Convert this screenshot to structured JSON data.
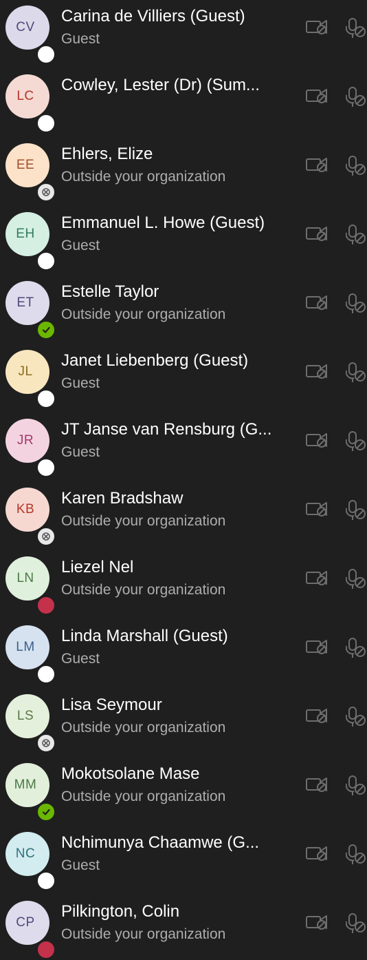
{
  "colors": {
    "background": "#1f1f1f",
    "name_text": "#ffffff",
    "secondary_text": "#adadad",
    "icon_gray": "#6e6e6e",
    "presence_available": "#6bb700",
    "presence_busy": "#c4314b",
    "presence_unknown": "#ffffff"
  },
  "participants": [
    {
      "initials": "CV",
      "name": "Carina de Villiers (Guest)",
      "subtitle": "Guest",
      "presence": "unknown",
      "avatar_bg": "#dcd9ea",
      "avatar_fg": "#4f4a7a",
      "camera_icon": "camera-off-icon",
      "mic_icon": "mic-off-icon"
    },
    {
      "initials": "LC",
      "name": "Cowley, Lester (Dr) (Sum...",
      "subtitle": "",
      "presence": "unknown",
      "avatar_bg": "#f5d9d3",
      "avatar_fg": "#b3382a",
      "camera_icon": "camera-off-icon",
      "mic_icon": "mic-off-icon"
    },
    {
      "initials": "EE",
      "name": "Ehlers, Elize",
      "subtitle": "Outside your organization",
      "presence": "offline",
      "avatar_bg": "#fbe2c8",
      "avatar_fg": "#a0522d",
      "camera_icon": "camera-off-icon",
      "mic_icon": "mic-off-icon"
    },
    {
      "initials": "EH",
      "name": "Emmanuel L. Howe (Guest)",
      "subtitle": "Guest",
      "presence": "unknown",
      "avatar_bg": "#d5efe2",
      "avatar_fg": "#2e7d5b",
      "camera_icon": "camera-off-icon",
      "mic_icon": "mic-off-icon"
    },
    {
      "initials": "ET",
      "name": "Estelle Taylor",
      "subtitle": "Outside your organization",
      "presence": "available",
      "avatar_bg": "#dedbec",
      "avatar_fg": "#4f4a7a",
      "camera_icon": "camera-off-icon",
      "mic_icon": "mic-off-icon"
    },
    {
      "initials": "JL",
      "name": "Janet Liebenberg (Guest)",
      "subtitle": "Guest",
      "presence": "unknown",
      "avatar_bg": "#f8e6bf",
      "avatar_fg": "#8a6d1d",
      "camera_icon": "camera-off-icon",
      "mic_icon": "mic-off-icon"
    },
    {
      "initials": "JR",
      "name": "JT Janse van Rensburg (G...",
      "subtitle": "Guest",
      "presence": "unknown",
      "avatar_bg": "#f4d3e0",
      "avatar_fg": "#a23a6a",
      "camera_icon": "camera-off-icon",
      "mic_icon": "mic-off-icon"
    },
    {
      "initials": "KB",
      "name": "Karen Bradshaw",
      "subtitle": "Outside your organization",
      "presence": "offline",
      "avatar_bg": "#f6d8d1",
      "avatar_fg": "#b3382a",
      "camera_icon": "camera-off-icon",
      "mic_icon": "mic-off-icon"
    },
    {
      "initials": "LN",
      "name": "Liezel Nel",
      "subtitle": "Outside your organization",
      "presence": "busy",
      "avatar_bg": "#dff0dc",
      "avatar_fg": "#4a7a45",
      "camera_icon": "camera-off-icon",
      "mic_icon": "mic-off-icon"
    },
    {
      "initials": "LM",
      "name": "Linda Marshall (Guest)",
      "subtitle": "Guest",
      "presence": "unknown",
      "avatar_bg": "#d6e2f0",
      "avatar_fg": "#3a5f8a",
      "camera_icon": "camera-off-icon",
      "mic_icon": "mic-off-icon"
    },
    {
      "initials": "LS",
      "name": "Lisa Seymour",
      "subtitle": "Outside your organization",
      "presence": "offline",
      "avatar_bg": "#e4f0dc",
      "avatar_fg": "#5a7a45",
      "camera_icon": "camera-off-icon",
      "mic_icon": "mic-off-icon"
    },
    {
      "initials": "MM",
      "name": "Mokotsolane Mase",
      "subtitle": "Outside your organization",
      "presence": "available",
      "avatar_bg": "#e2efdb",
      "avatar_fg": "#4a7a45",
      "camera_icon": "camera-off-icon",
      "mic_icon": "mic-off-icon"
    },
    {
      "initials": "NC",
      "name": "Nchimunya Chaamwe (G...",
      "subtitle": "Guest",
      "presence": "unknown",
      "avatar_bg": "#d3ecef",
      "avatar_fg": "#2e7080",
      "camera_icon": "camera-off-icon",
      "mic_icon": "mic-off-icon"
    },
    {
      "initials": "CP",
      "name": "Pilkington, Colin",
      "subtitle": "Outside your organization",
      "presence": "busy",
      "avatar_bg": "#dedbec",
      "avatar_fg": "#4f4a7a",
      "camera_icon": "camera-off-icon",
      "mic_icon": "mic-off-icon"
    }
  ]
}
